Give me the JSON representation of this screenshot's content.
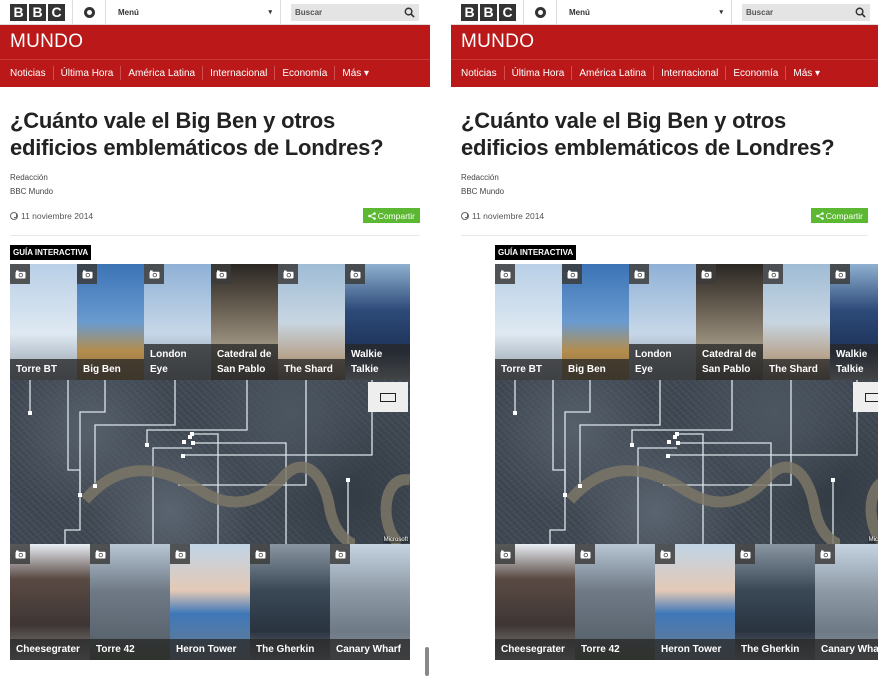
{
  "header": {
    "logo_letters": [
      "B",
      "B",
      "C"
    ],
    "menu_label": "Menú",
    "menu_caret": "▾",
    "search_placeholder": "Buscar",
    "brand": "MUNDO"
  },
  "nav": {
    "items": [
      "Noticias",
      "Última Hora",
      "América Latina",
      "Internacional",
      "Economía",
      "Más ▾"
    ]
  },
  "article": {
    "title": "¿Cuánto vale el Big Ben y otros edificios emblemáticos de Londres?",
    "author": "Redacción",
    "outlet": "BBC Mundo",
    "date": "11 noviembre 2014",
    "share_label": "Compartir"
  },
  "guide": {
    "label": "GUÍA INTERACTIVA",
    "map_credit": "Microsoft",
    "top_row": [
      {
        "name": "Torre BT",
        "icon": "camera-icon"
      },
      {
        "name": "Big Ben",
        "icon": "camera-icon"
      },
      {
        "name": "London Eye",
        "icon": "camera-icon"
      },
      {
        "name": "Catedral de San Pablo",
        "icon": "camera-icon"
      },
      {
        "name": "The Shard",
        "icon": "camera-icon"
      },
      {
        "name": "Walkie Talkie",
        "icon": "camera-icon"
      }
    ],
    "bottom_row": [
      {
        "name": "Cheesegrater",
        "icon": "camera-icon"
      },
      {
        "name": "Torre 42",
        "icon": "camera-icon"
      },
      {
        "name": "Heron Tower",
        "icon": "camera-icon"
      },
      {
        "name": "The Gherkin",
        "icon": "camera-icon"
      },
      {
        "name": "Canary Wharf",
        "icon": "camera-icon"
      }
    ]
  },
  "colors": {
    "brand_red": "#bb1919",
    "share_green": "#5cb833"
  }
}
